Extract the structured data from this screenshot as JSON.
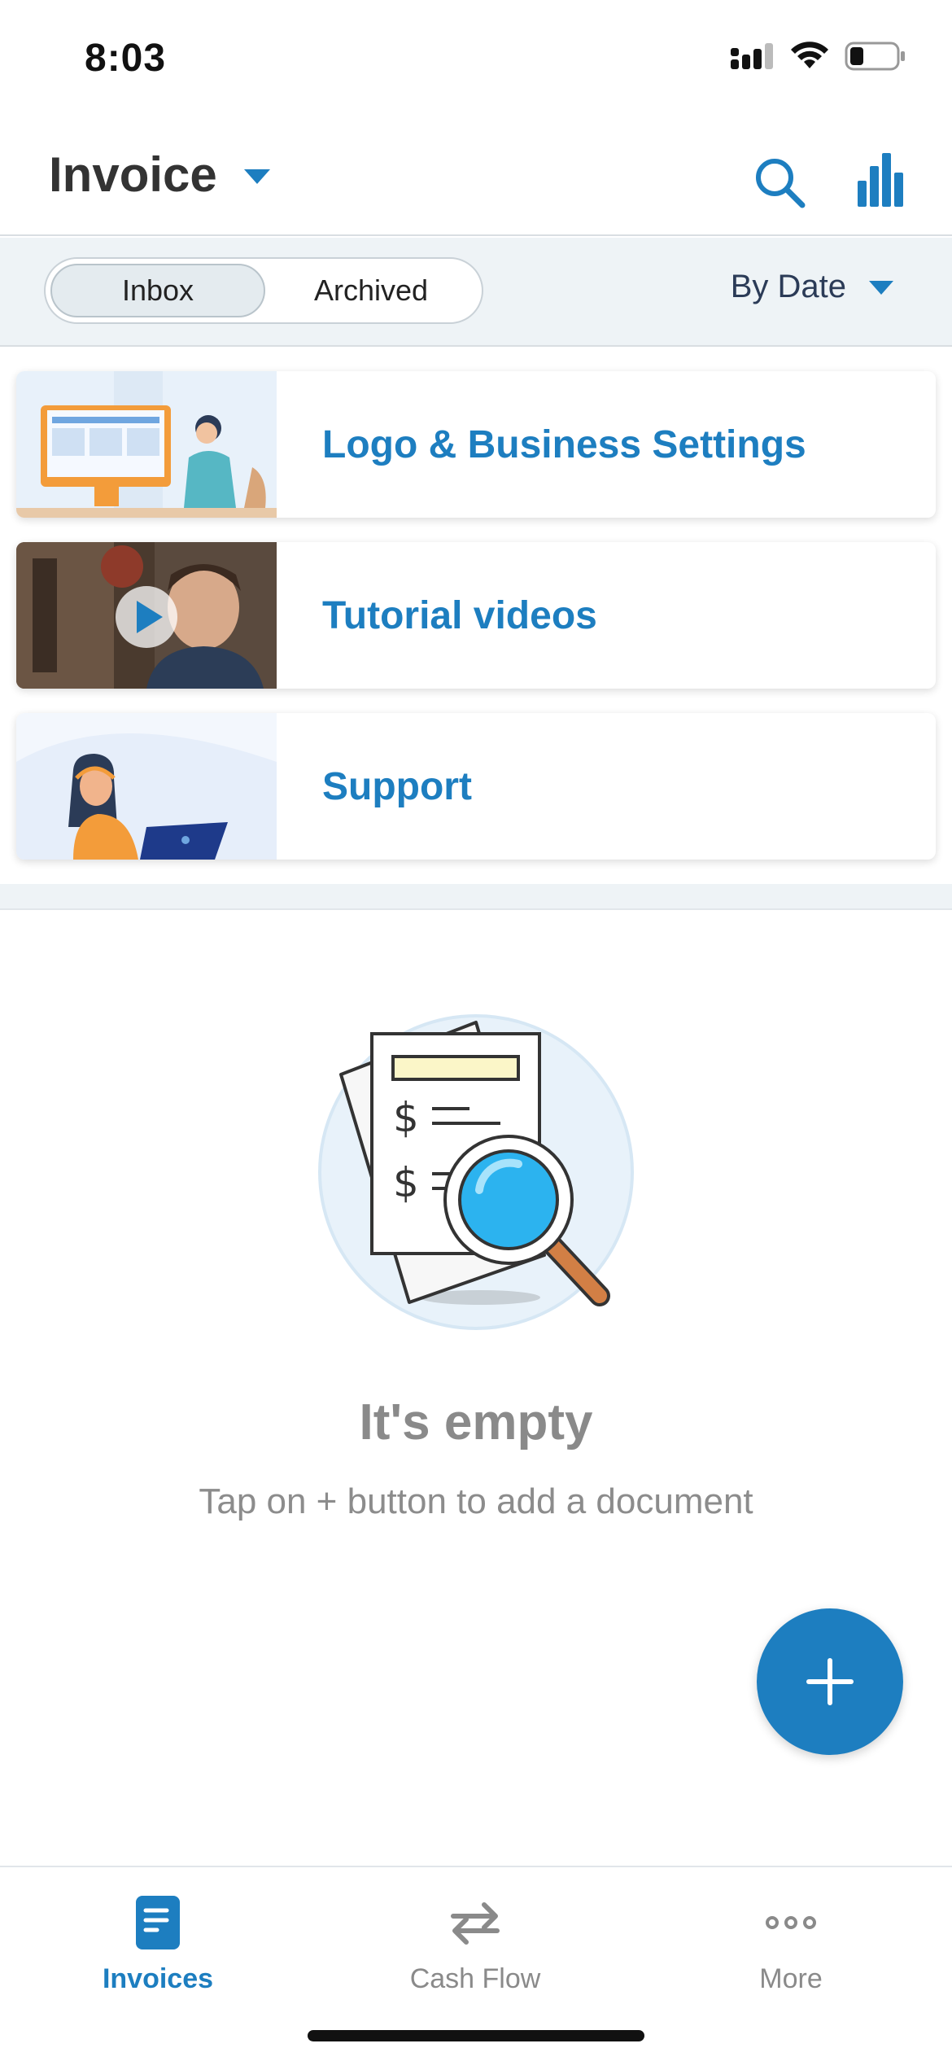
{
  "status_bar": {
    "time": "8:03",
    "icons": [
      "cellular-signal-icon",
      "wifi-icon",
      "battery-icon"
    ]
  },
  "header": {
    "title": "Invoice",
    "icons": [
      "chevron-down-icon",
      "search-icon",
      "bar-chart-icon"
    ]
  },
  "filter": {
    "segments": [
      "Inbox",
      "Archived"
    ],
    "selected_segment": "Inbox",
    "sort_label": "By Date"
  },
  "cards": [
    {
      "label": "Logo & Business Settings",
      "thumb": "person-at-computer-illustration"
    },
    {
      "label": "Tutorial videos",
      "thumb": "video-play-thumbnail"
    },
    {
      "label": "Support",
      "thumb": "support-agent-illustration"
    }
  ],
  "empty_state": {
    "title": "It's empty",
    "subtitle": "Tap on + button to add a document",
    "illustration": "document-magnifier-illustration"
  },
  "fab": {
    "icon": "plus-icon"
  },
  "tabs": [
    {
      "label": "Invoices",
      "icon": "document-icon",
      "active": true
    },
    {
      "label": "Cash Flow",
      "icon": "swap-arrows-icon",
      "active": false
    },
    {
      "label": "More",
      "icon": "more-dots-icon",
      "active": false
    }
  ],
  "colors": {
    "accent": "#1d7ec0",
    "text_primary": "#333333",
    "text_muted": "#8a8a8a",
    "filter_background": "#eef3f6"
  }
}
